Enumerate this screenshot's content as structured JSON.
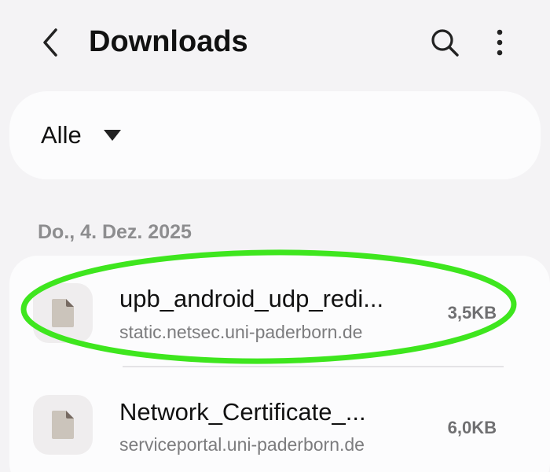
{
  "header": {
    "title": "Downloads",
    "back_icon": "chevron-left-icon",
    "search_icon": "search-icon",
    "more_icon": "more-vertical-icon"
  },
  "filter": {
    "selected": "Alle"
  },
  "section": {
    "date": "Do., 4. Dez. 2025"
  },
  "files": [
    {
      "name": "upb_android_udp_redi...",
      "source": "static.netsec.uni-paderborn.de",
      "size": "3,5KB",
      "icon": "file-icon"
    },
    {
      "name": "Network_Certificate_...",
      "source": "serviceportal.uni-paderborn.de",
      "size": "6,0KB",
      "icon": "file-icon"
    }
  ],
  "colors": {
    "background": "#f4f3f5",
    "card": "#fcfcfd",
    "highlight": "#3ee61e",
    "secondary_text": "#7c7c7e"
  }
}
